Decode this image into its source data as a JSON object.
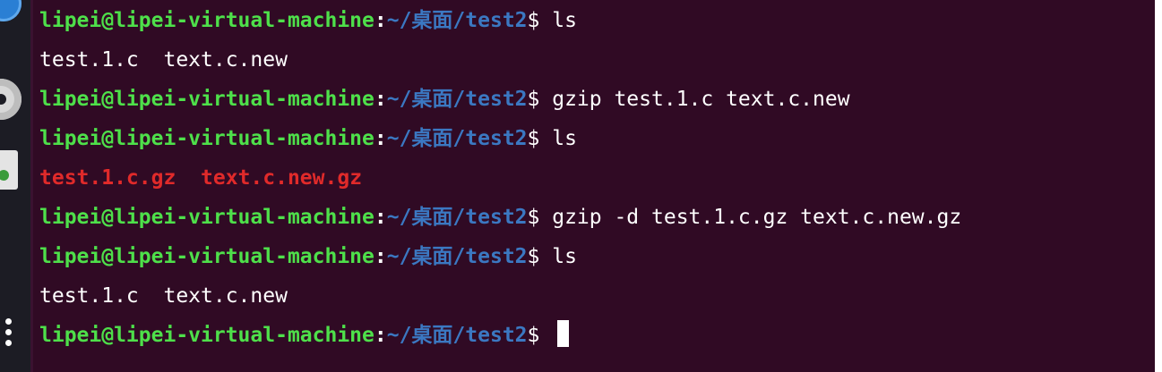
{
  "terminal": {
    "colors": {
      "background": "#300a24",
      "user_host": "#4ee04a",
      "path": "#3b78c2",
      "archive_file": "#e02a2a",
      "text": "#ffffff"
    },
    "lines": [
      {
        "type": "prompt",
        "user_host": "lipei@lipei-virtual-machine",
        "colon": ":",
        "path": "~/桌面/test2",
        "dollar": "$",
        "command": " ls"
      },
      {
        "type": "output",
        "text": "test.1.c  text.c.new"
      },
      {
        "type": "prompt",
        "user_host": "lipei@lipei-virtual-machine",
        "colon": ":",
        "path": "~/桌面/test2",
        "dollar": "$",
        "command": " gzip test.1.c text.c.new"
      },
      {
        "type": "prompt",
        "user_host": "lipei@lipei-virtual-machine",
        "colon": ":",
        "path": "~/桌面/test2",
        "dollar": "$",
        "command": " ls"
      },
      {
        "type": "archive_output",
        "files": [
          "test.1.c.gz",
          "text.c.new.gz"
        ]
      },
      {
        "type": "prompt",
        "user_host": "lipei@lipei-virtual-machine",
        "colon": ":",
        "path": "~/桌面/test2",
        "dollar": "$",
        "command": " gzip -d test.1.c.gz text.c.new.gz"
      },
      {
        "type": "prompt",
        "user_host": "lipei@lipei-virtual-machine",
        "colon": ":",
        "path": "~/桌面/test2",
        "dollar": "$",
        "command": " ls"
      },
      {
        "type": "output",
        "text": "test.1.c  text.c.new"
      },
      {
        "type": "prompt",
        "user_host": "lipei@lipei-virtual-machine",
        "colon": ":",
        "path": "~/桌面/test2",
        "dollar": "$",
        "command": " "
      }
    ]
  },
  "dock": {
    "icons": [
      "ubuntu-icon",
      "disc-icon",
      "trash-icon",
      "show-apps-icon"
    ]
  }
}
